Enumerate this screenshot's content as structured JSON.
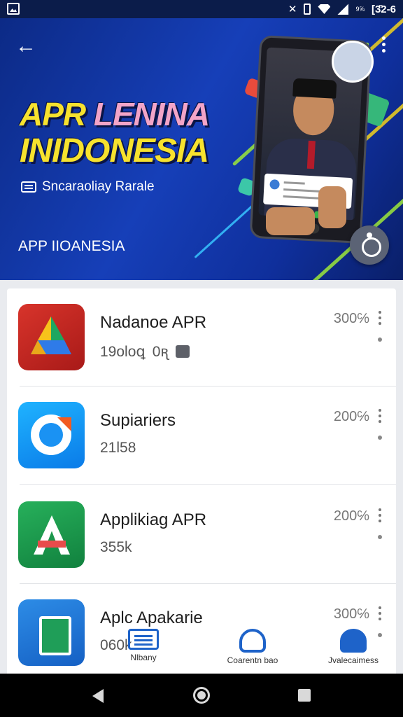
{
  "status_bar": {
    "battery_text": "9⅝",
    "time": "[3̄2-6"
  },
  "banner": {
    "title_line1_a": "APR ",
    "title_line1_b": "LENINA",
    "title_line2": "INIDONESIA",
    "tagline": "Sncaraoliay Rarale",
    "subtitle": "APP IIOANESIA",
    "colors": {
      "title": "#f7e22e",
      "accent_pink": "#f2a4c8",
      "background": "#163fb8"
    }
  },
  "apps": [
    {
      "title": "Nadanoe APR",
      "meta": "19oloꝗ",
      "meta_extra": "0ꭆ",
      "percent": "300℅",
      "icon": "drive-triangle-icon"
    },
    {
      "title": "Supiariers",
      "meta": "21l58",
      "percent": "200℅",
      "icon": "sync-ring-icon"
    },
    {
      "title": "Applikiag APR",
      "meta": "355k",
      "percent": "200℅",
      "icon": "letter-a-icon"
    },
    {
      "title": "Aplc Apakarie",
      "meta": "060k",
      "percent": "300℅",
      "icon": "spreadsheet-icon"
    }
  ],
  "bottom_nav": [
    {
      "label": "Nlbany",
      "icon": "library-icon"
    },
    {
      "label": "Coarentn bao",
      "icon": "account-icon"
    },
    {
      "label": "Jvalecaimess",
      "icon": "updates-icon"
    }
  ]
}
